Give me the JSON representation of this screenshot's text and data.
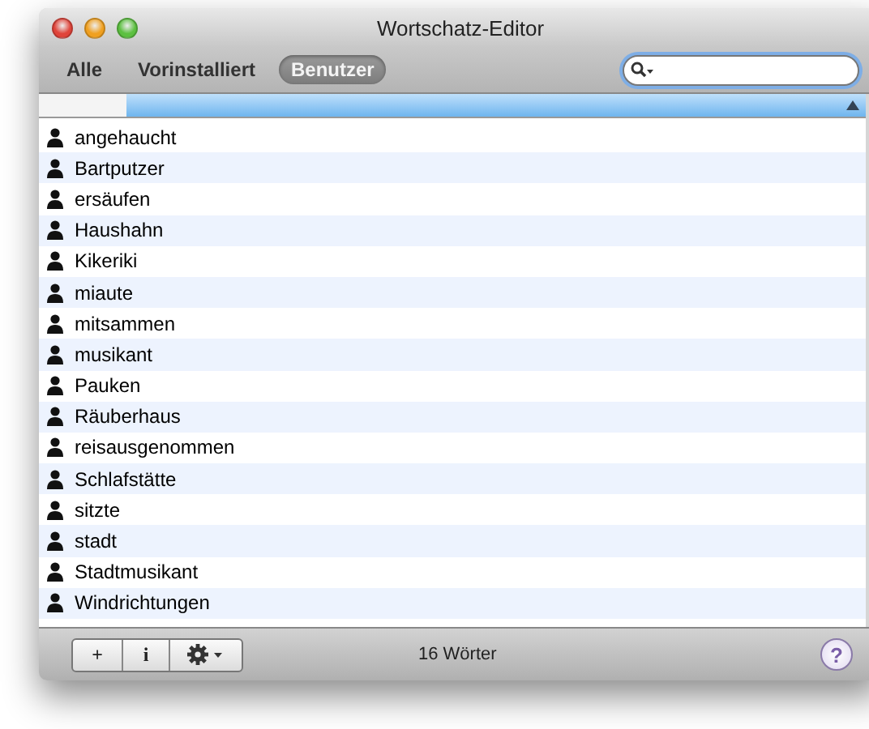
{
  "window": {
    "title": "Wortschatz-Editor"
  },
  "scopes": [
    {
      "label": "Alle",
      "selected": false
    },
    {
      "label": "Vorinstalliert",
      "selected": false
    },
    {
      "label": "Benutzer",
      "selected": true
    }
  ],
  "search": {
    "focused": true
  },
  "table": {
    "sort_ascending": true,
    "rows": [
      {
        "word": "angehaucht"
      },
      {
        "word": "Bartputzer"
      },
      {
        "word": "ersäufen"
      },
      {
        "word": "Haushahn"
      },
      {
        "word": "Kikeriki"
      },
      {
        "word": "miaute"
      },
      {
        "word": "mitsammen"
      },
      {
        "word": "musikant"
      },
      {
        "word": "Pauken"
      },
      {
        "word": "Räuberhaus"
      },
      {
        "word": "reisausgenommen"
      },
      {
        "word": "Schlafstätte"
      },
      {
        "word": "sitzte"
      },
      {
        "word": "stadt"
      },
      {
        "word": "Stadtmusikant"
      },
      {
        "word": "Windrichtungen"
      }
    ]
  },
  "bottom_bar": {
    "add_label": "+",
    "info_label": "i",
    "status": "16 Wörter",
    "help_label": "?"
  }
}
